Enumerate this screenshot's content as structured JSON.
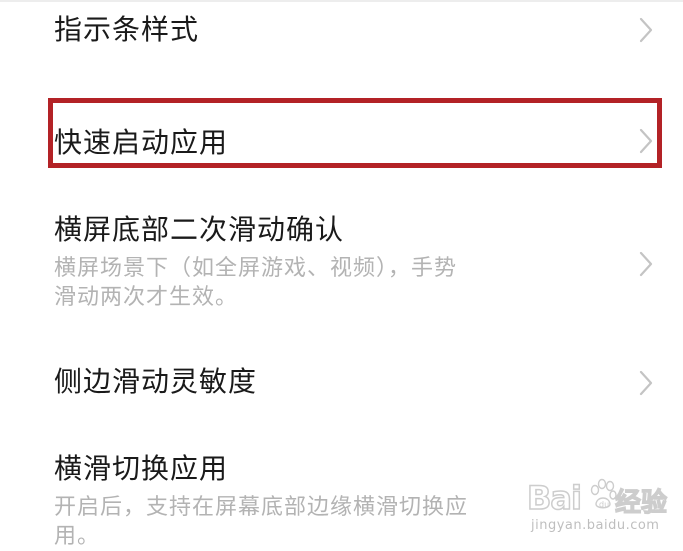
{
  "settings": {
    "items": [
      {
        "title": "指示条样式",
        "icon": "chevron-right-icon"
      },
      {
        "title": "快速启动应用",
        "icon": "chevron-right-icon"
      },
      {
        "title": "横屏底部二次滑动确认",
        "subtitle_line1": "横屏场景下（如全屏游戏、视频），手势",
        "subtitle_line2": "滑动两次才生效。",
        "icon": "chevron-right-icon"
      },
      {
        "title": "侧边滑动灵敏度",
        "icon": "chevron-right-icon"
      },
      {
        "title": "横滑切换应用",
        "subtitle_line1": "开启后，支持在屏幕底部边缘横滑切换应",
        "subtitle_line2": "用。"
      }
    ]
  },
  "highlight": {
    "color": "#b32226"
  },
  "watermark": {
    "brand": "Bai",
    "brand2": "du",
    "cn": "经验",
    "url": "jingyan.baidu.com"
  },
  "colors": {
    "title": "#1a1a1a",
    "subtitle": "#b3b3b3",
    "chevron": "#c4c4c4",
    "divider": "#ededed"
  }
}
